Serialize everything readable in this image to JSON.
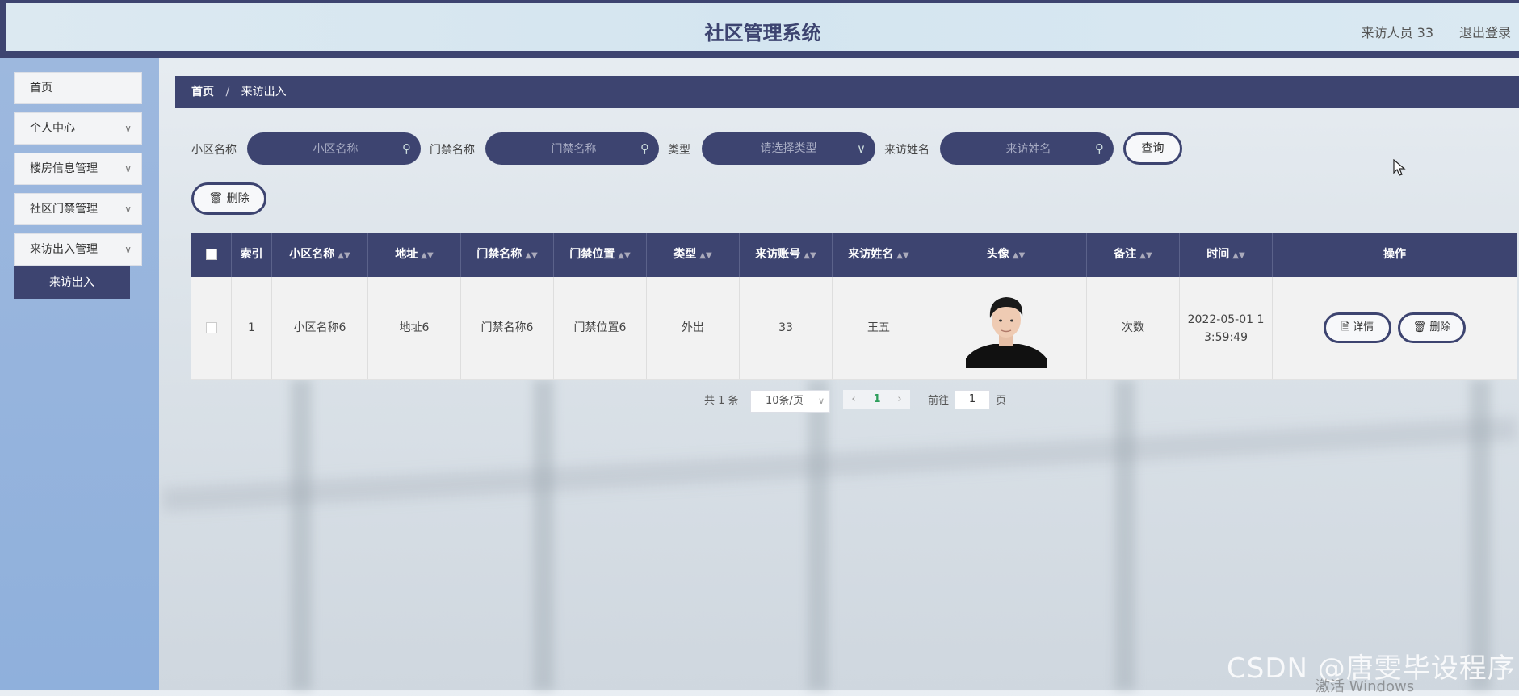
{
  "header": {
    "title": "社区管理系统",
    "user_info": "来访人员 33",
    "logout": "退出登录"
  },
  "sidebar": {
    "items": [
      {
        "label": "首页",
        "has_children": false
      },
      {
        "label": "个人中心",
        "has_children": true
      },
      {
        "label": "楼房信息管理",
        "has_children": true
      },
      {
        "label": "社区门禁管理",
        "has_children": true
      },
      {
        "label": "来访出入管理",
        "has_children": true
      }
    ],
    "active_subitem": "来访出入"
  },
  "breadcrumb": {
    "home": "首页",
    "separator": "/",
    "current": "来访出入"
  },
  "search": {
    "community_label": "小区名称",
    "community_placeholder": "小区名称",
    "gate_label": "门禁名称",
    "gate_placeholder": "门禁名称",
    "type_label": "类型",
    "type_placeholder": "请选择类型",
    "visitor_label": "来访姓名",
    "visitor_placeholder": "来访姓名",
    "query_button": "查询"
  },
  "actions": {
    "delete_button": "删除"
  },
  "table": {
    "columns": [
      "索引",
      "小区名称",
      "地址",
      "门禁名称",
      "门禁位置",
      "类型",
      "来访账号",
      "来访姓名",
      "头像",
      "备注",
      "时间",
      "操作"
    ],
    "rows": [
      {
        "index": "1",
        "community": "小区名称6",
        "address": "地址6",
        "gate_name": "门禁名称6",
        "gate_location": "门禁位置6",
        "type": "外出",
        "visitor_account": "33",
        "visitor_name": "王五",
        "remark": "次数",
        "time_line1": "2022-05-01 1",
        "time_line2": "3:59:49",
        "detail_button": "详情",
        "delete_button": "删除"
      }
    ]
  },
  "pagination": {
    "total": "共 1 条",
    "page_size": "10条/页",
    "current_page": "1",
    "goto_label": "前往",
    "goto_value": "1",
    "page_suffix": "页"
  },
  "overlay": {
    "watermark": "CSDN @唐雯毕设程序",
    "activate": "激活 Windows"
  },
  "colors": {
    "primary": "#3d4470",
    "sidebar_bg": "#94b3dd",
    "header_bg": "#d8e8f1",
    "active_page": "#2e9e5b"
  }
}
